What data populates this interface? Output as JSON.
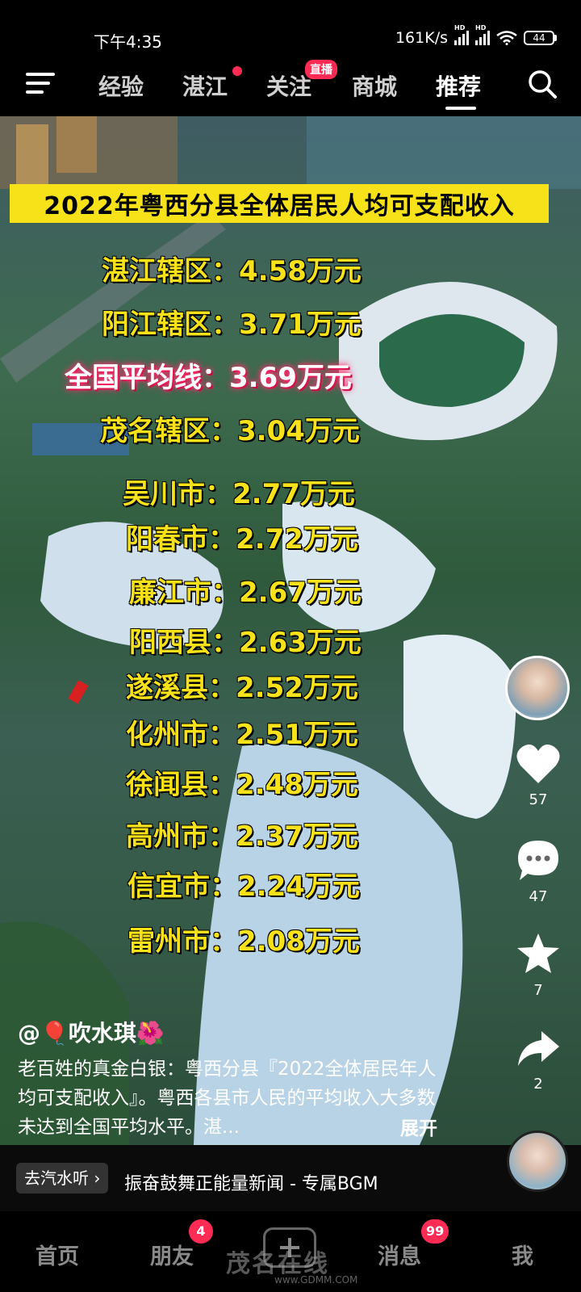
{
  "status_bar": {
    "time": "下午4:35",
    "net_speed": "161K/s",
    "signal_label_1": "HD",
    "signal_label_2": "HD",
    "battery": "44"
  },
  "top_nav": {
    "tabs": [
      {
        "label": "经验",
        "active": false
      },
      {
        "label": "湛江",
        "active": false,
        "dot": true
      },
      {
        "label": "关注",
        "active": false,
        "badge": "直播"
      },
      {
        "label": "商城",
        "active": false
      },
      {
        "label": "推荐",
        "active": true
      }
    ]
  },
  "video": {
    "title": "2022年粤西分县全体居民人均可支配收入",
    "rows": [
      {
        "text": "湛江辖区：4.58万元",
        "highlight": false
      },
      {
        "text": "阳江辖区：3.71万元",
        "highlight": false
      },
      {
        "text": "全国平均线：3.69万元",
        "highlight": true
      },
      {
        "text": "茂名辖区：3.04万元",
        "highlight": false
      },
      {
        "text": "吴川市：2.77万元",
        "highlight": false
      },
      {
        "text": "阳春市：2.72万元",
        "highlight": false
      },
      {
        "text": "廉江市：2.67万元",
        "highlight": false
      },
      {
        "text": "阳西县：2.63万元",
        "highlight": false
      },
      {
        "text": "遂溪县：2.52万元",
        "highlight": false
      },
      {
        "text": "化州市：2.51万元",
        "highlight": false
      },
      {
        "text": "徐闻县：2.48万元",
        "highlight": false
      },
      {
        "text": "高州市：2.37万元",
        "highlight": false
      },
      {
        "text": "信宜市：2.24万元",
        "highlight": false
      },
      {
        "text": "雷州市：2.08万元",
        "highlight": false
      }
    ]
  },
  "actions": {
    "likes": "57",
    "comments": "47",
    "favorites": "7",
    "shares": "2"
  },
  "caption": {
    "author": "@🎈吹水琪🌺",
    "text": "老百姓的真金白银：粤西分县『2022全体居民年人均可支配收入』。粤西各县市人民的平均收入大多数未达到全国平均水平。湛...",
    "expand": "展开"
  },
  "music": {
    "chip": "去汽水听 ›",
    "title": "振奋鼓舞正能量新闻 - 专属BGM"
  },
  "bottom_nav": {
    "home": "首页",
    "friends": "朋友",
    "friends_badge": "4",
    "messages": "消息",
    "messages_badge": "99",
    "me": "我",
    "watermark": "茂名在线",
    "watermark_url": "www.GDMM.COM"
  }
}
